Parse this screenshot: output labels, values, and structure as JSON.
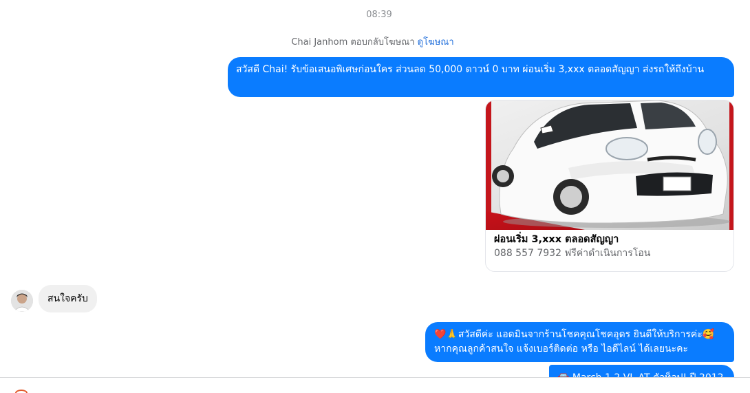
{
  "chat": {
    "timestamp": "08:39",
    "reply_note": {
      "text": "Chai Janhom ตอบกลับโฆษณา ",
      "link": "ดูโฆษณา"
    },
    "messages": [
      {
        "direction": "outgoing",
        "text": "สวัสดี Chai! รับข้อเสนอพิเศษก่อนใคร ส่วนลด 50,000 ดาวน์ 0 บาท ผ่อนเริ่ม 3,xxx ตลอดสัญญา ส่งรถให้ถึงบ้าน"
      },
      {
        "direction": "outgoing",
        "type": "ad_card",
        "image": "white-hatchback-car",
        "title": "ผ่อนเริ่ม 3,xxx ตลอดสัญญา",
        "subtitle": "088 557 7932 ฟรีค่าดำเนินการโอน"
      },
      {
        "direction": "incoming",
        "avatar": "user-avatar",
        "text": "สนใจครับ"
      },
      {
        "direction": "outgoing",
        "text_line1": "❤️🙏สวัสดีค่ะ แอดมินจากร้านโชคคุณโชคอุดร ยินดีให้บริการค่ะ🥰",
        "text_line2": "หากคุณลูกค้าสนใจ แจ้งเบอร์ติดต่อ หรือ ไอดีไลน์ ได้เลยนะคะ"
      },
      {
        "direction": "outgoing",
        "text": "🚘 March 1.2 VL AT ตัวท็อป! ปี 2012"
      }
    ]
  },
  "colors": {
    "outgoing_bubble": "#0a7cff",
    "incoming_bubble": "#f0f0f0",
    "link": "#216fdb"
  }
}
